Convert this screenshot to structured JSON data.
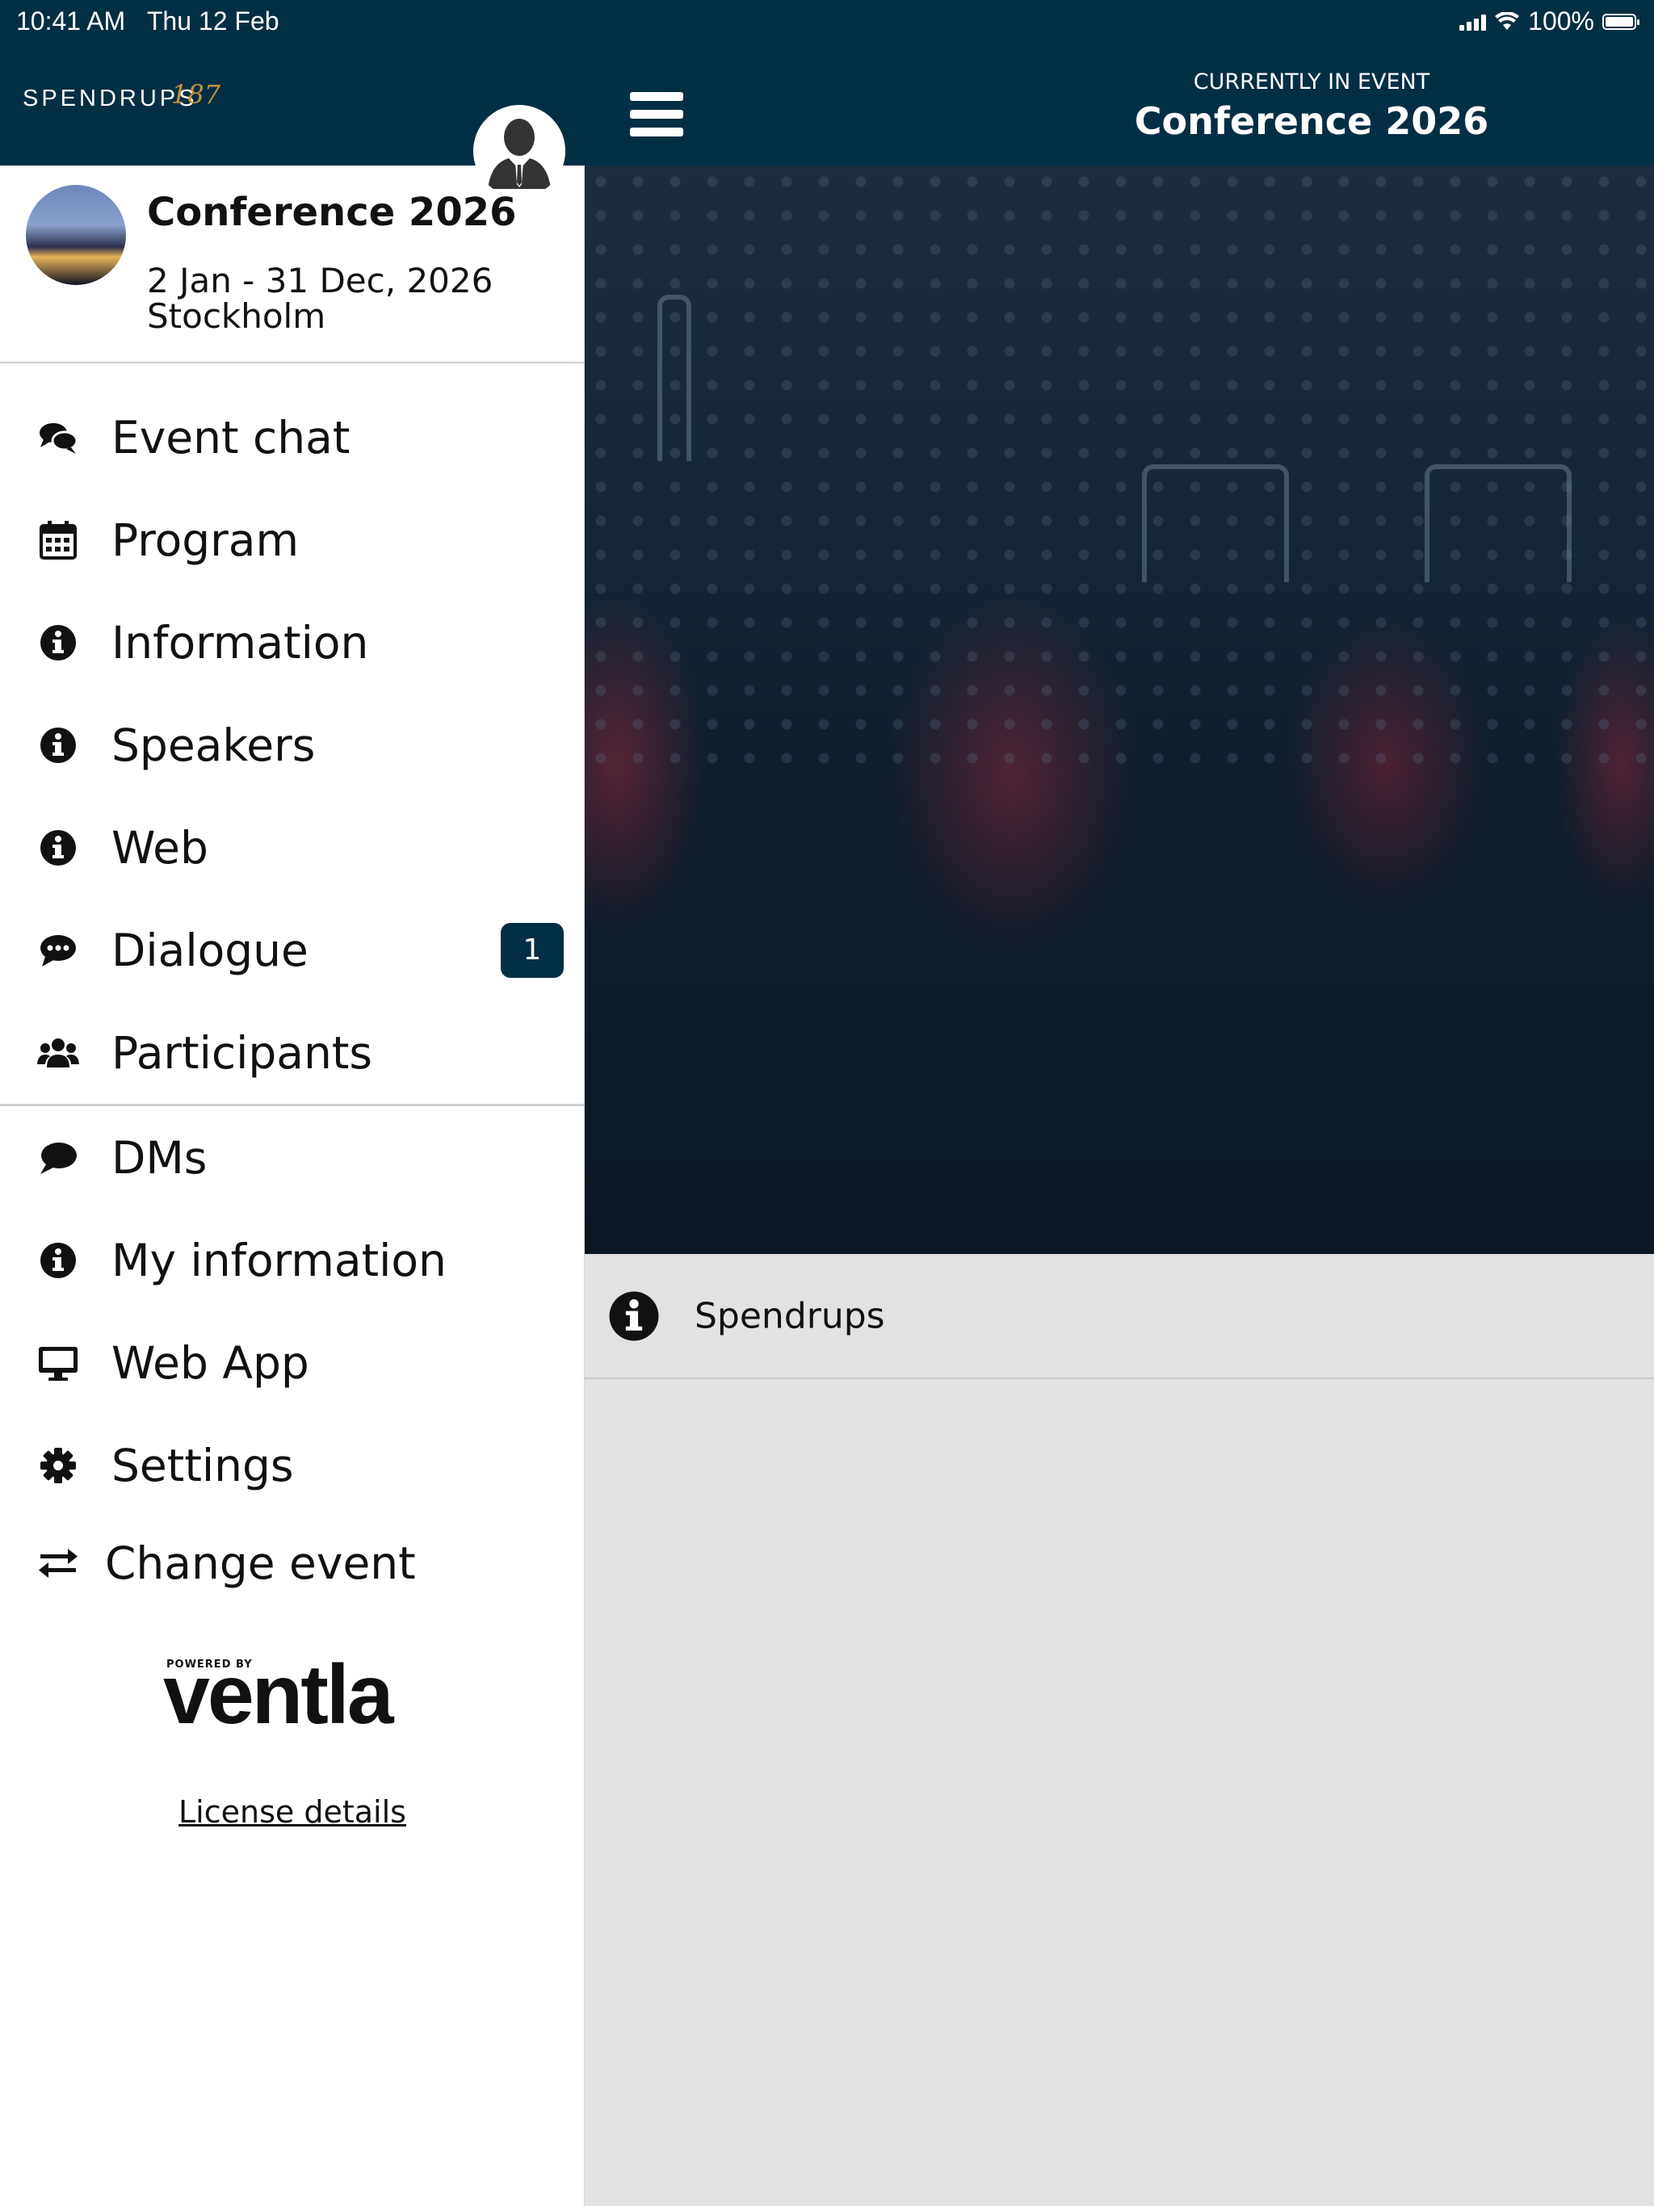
{
  "status_bar": {
    "time": "10:41 AM",
    "date": "Thu 12 Feb",
    "battery": "100%"
  },
  "sidebar": {
    "brand": {
      "name": "SPENDRUPS",
      "number": "187"
    },
    "event": {
      "name": "Conference 2026",
      "dates": "2 Jan - 31 Dec, 2026",
      "city": "Stockholm"
    },
    "menu_group_1": [
      {
        "label": "Event chat",
        "icon": "comments-icon"
      },
      {
        "label": "Program",
        "icon": "calendar-icon"
      },
      {
        "label": "Information",
        "icon": "info-icon"
      },
      {
        "label": "Speakers",
        "icon": "info-icon"
      },
      {
        "label": "Web",
        "icon": "info-icon"
      },
      {
        "label": "Dialogue",
        "icon": "comment-dots-icon",
        "badge": "1"
      },
      {
        "label": "Participants",
        "icon": "users-icon"
      }
    ],
    "menu_group_2": [
      {
        "label": "DMs",
        "icon": "comment-icon"
      },
      {
        "label": "My information",
        "icon": "info-icon"
      },
      {
        "label": "Web App",
        "icon": "desktop-icon"
      },
      {
        "label": "Settings",
        "icon": "gear-icon"
      },
      {
        "label": "Change event",
        "icon": "exchange-icon"
      }
    ],
    "powered_by": "POWERED BY",
    "powered_brand": "ventla",
    "license_link": "License details"
  },
  "header": {
    "current_label": "CURRENTLY IN EVENT",
    "current_event": "Conference 2026"
  },
  "main": {
    "info_item": {
      "label": "Spendrups",
      "icon": "info-icon"
    }
  },
  "colors": {
    "brand_navy": "#032f44",
    "panel_gray": "#e2e2e2",
    "logo_gold": "#c7913a"
  }
}
